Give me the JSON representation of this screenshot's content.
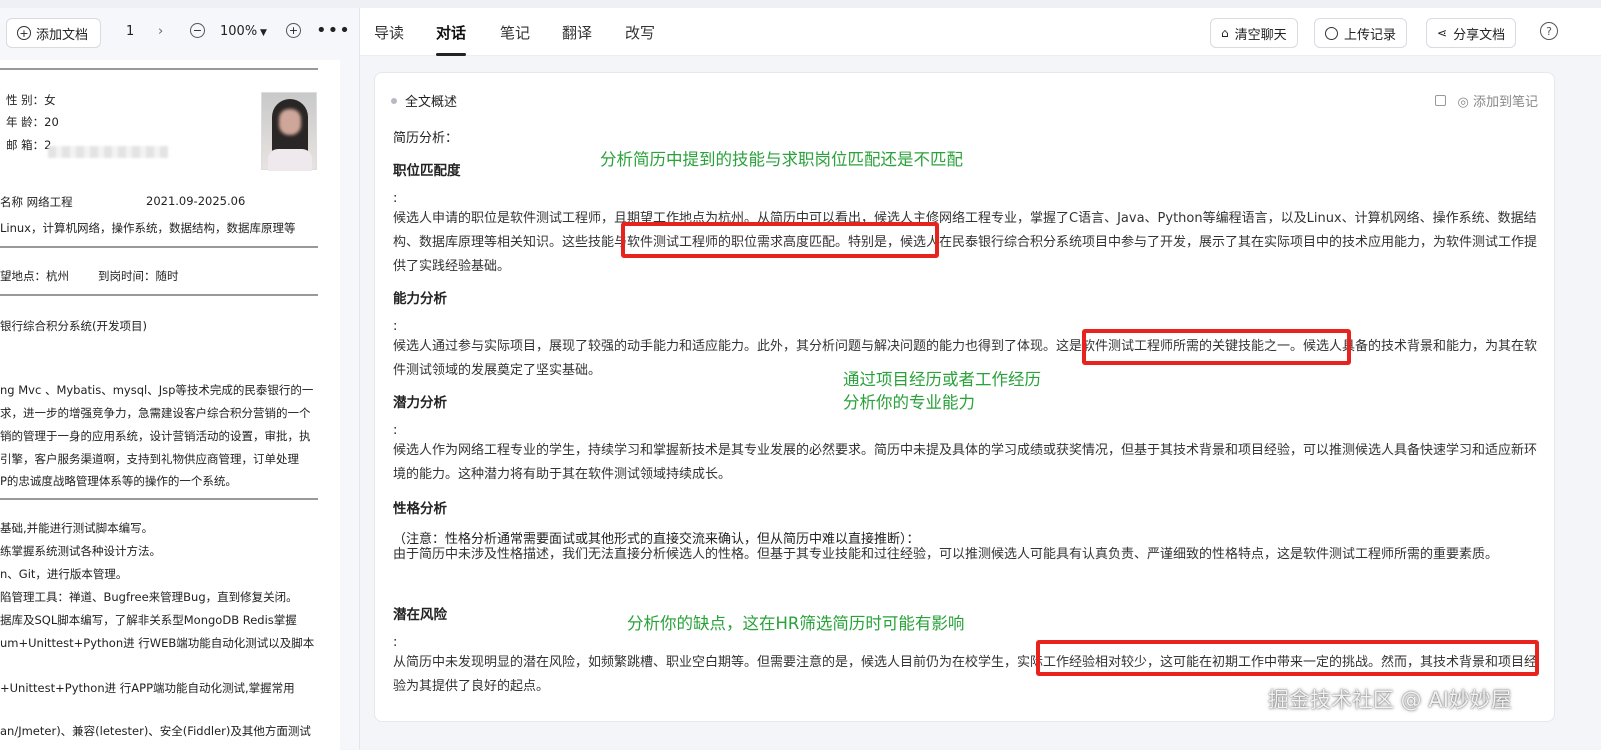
{
  "toolbar": {
    "add_doc": "添加文档",
    "page": "1",
    "zoom": "100%"
  },
  "tabs": [
    {
      "label": "导读"
    },
    {
      "label": "对话"
    },
    {
      "label": "笔记"
    },
    {
      "label": "翻译"
    },
    {
      "label": "改写"
    }
  ],
  "actions": {
    "clear_chat": "清空聊天",
    "upload_history": "上传记录",
    "share_doc": "分享文档",
    "help": "?"
  },
  "document": {
    "lines": [
      "性  别：女",
      "年  龄：20",
      "邮  箱：2",
      "名称  网络工程",
      "2021.09-2025.06",
      "Linux，计算机网络，操作系统，数据结构，数据库原理等",
      "望地点：杭州",
      "到岗时间：随时",
      "银行综合积分系统(开发项目)",
      "ng Mvc 、Mybatis、mysql、Jsp等技术完成的民泰银行的一",
      "求，进一步的增强竞争力，急需建设客户综合积分营销的一个",
      "销的管理于一身的应用系统，设计营销活动的设置，审批，执",
      "引擎，客户服务渠道啊，支持到礼物供应商管理，订单处理",
      "P的忠诚度战略管理体系等的操作的一个系统。",
      "基础,并能进行测试脚本编写。",
      "练掌握系统测试各种设计方法。",
      "n、Git，进行版本管理。",
      "陷管理工具：禅道、Bugfree来管理Bug，直到修复关闭。",
      "据库及SQL脚本编写，了解非关系型MongoDB Redis掌握",
      "um+Unittest+Python进 行WEB端功能自动化测试以及脚本",
      "+Unittest+Python进 行APP端功能自动化测试,掌握常用",
      "an/Jmeter)、兼容(letester)、安全(Fiddler)及其他方面测试"
    ]
  },
  "summary": {
    "header": "全文概述",
    "add_to_notes": "添加到笔记",
    "intro": "简历分析：",
    "sections": [
      {
        "title": "职位匹配度",
        "colon": ":",
        "text": "候选人申请的职位是软件测试工程师，且期望工作地点为杭州。从简历中可以看出，候选人主修网络工程专业，掌握了C语言、Java、Python等编程语言，以及Linux、计算机网络、操作系统、数据结构、数据库原理等相关知识。这些技能与软件测试工程师的职位需求高度匹配。特别是，候选人在民泰银行综合积分系统项目中参与了开发，展示了其在实际项目中的技术应用能力，为软件测试工作提供了实践经验基础。"
      },
      {
        "title": "能力分析",
        "colon": ":",
        "text": "候选人通过参与实际项目，展现了较强的动手能力和适应能力。此外，其分析问题与解决问题的能力也得到了体现。这是软件测试工程师所需的关键技能之一。候选人具备的技术背景和能力，为其在软件测试领域的发展奠定了坚实基础。"
      },
      {
        "title": "潜力分析",
        "colon": ":",
        "text": "候选人作为网络工程专业的学生，持续学习和掌握新技术是其专业发展的必然要求。简历中未提及具体的学习成绩或获奖情况，但基于其技术背景和项目经验，可以推测候选人具备快速学习和适应新环境的能力。这种潜力将有助于其在软件测试领域持续成长。"
      },
      {
        "title": "性格分析",
        "colon": "（注意：性格分析通常需要面试或其他形式的直接交流来确认，但从简历中难以直接推断）：",
        "text": "由于简历中未涉及性格描述，我们无法直接分析候选人的性格。但基于其专业技能和过往经验，可以推测候选人可能具有认真负责、严谨细致的性格特点，这是软件测试工程师所需的重要素质。"
      },
      {
        "title": "潜在风险",
        "colon": ":",
        "text": "从简历中未发现明显的潜在风险，如频繁跳槽、职业空白期等。但需要注意的是，候选人目前仍为在校学生，实际工作经验相对较少，这可能在初期工作中带来一定的挑战。然而，其技术背景和项目经验为其提供了良好的起点。"
      }
    ]
  },
  "annotations": [
    "分析简历中提到的技能与求职岗位匹配还是不匹配",
    "通过项目经历或者工作经历",
    "分析你的专业能力",
    "分析你的缺点，这在HR筛选简历时可能有影响"
  ],
  "watermark": "掘金技术社区 @ AI妙妙屋",
  "colors": {
    "annotation": "#29a23a",
    "highlight_box": "#e8221d"
  }
}
